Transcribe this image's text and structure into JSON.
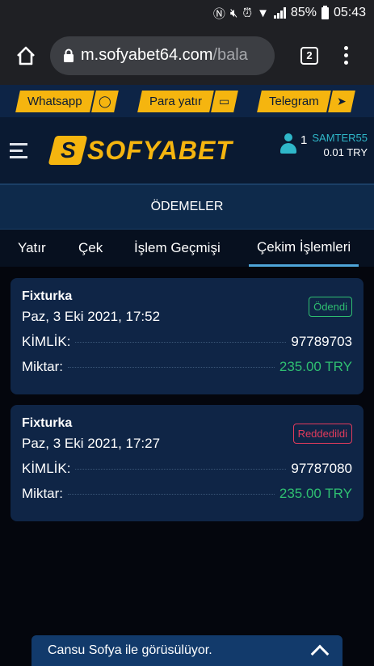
{
  "status_bar": {
    "battery": "85%",
    "time": "05:43"
  },
  "browser": {
    "url_main": "m.sofyabet64.com",
    "url_rest": "/bala",
    "tab_count": "2"
  },
  "top_links": [
    {
      "label": "Whatsapp"
    },
    {
      "label": "Para yatır"
    },
    {
      "label": "Telegram"
    }
  ],
  "header": {
    "logo_letter": "S",
    "logo_text": "SOFYABET",
    "user_count": "1",
    "username": "SAMTER55",
    "balance": "0.01 TRY"
  },
  "section_title": "ÖDEMELER",
  "tabs": [
    {
      "label": "Yatır"
    },
    {
      "label": "Çek"
    },
    {
      "label": "İşlem Geçmişi"
    },
    {
      "label": "Çekim İşlemleri",
      "active": true
    }
  ],
  "withdrawals": [
    {
      "method": "Fixturka",
      "date": "Paz, 3 Eki 2021, 17:52",
      "status": "Ödendi",
      "id_label": "KİMLİK:",
      "id": "97789703",
      "amount_label": "Miktar:",
      "amount": "235.00 TRY"
    },
    {
      "method": "Fixturka",
      "date": "Paz, 3 Eki 2021, 17:27",
      "status": "Reddedildi",
      "id_label": "KİMLİK:",
      "id": "97787080",
      "amount_label": "Miktar:",
      "amount": "235.00 TRY"
    }
  ],
  "chat": {
    "text": "Cansu Sofya ile görüsülüyor."
  },
  "colors": {
    "accent": "#f5b50f",
    "paid": "#2fbf71",
    "rejected": "#e23b5c",
    "username": "#2fb7c9"
  }
}
